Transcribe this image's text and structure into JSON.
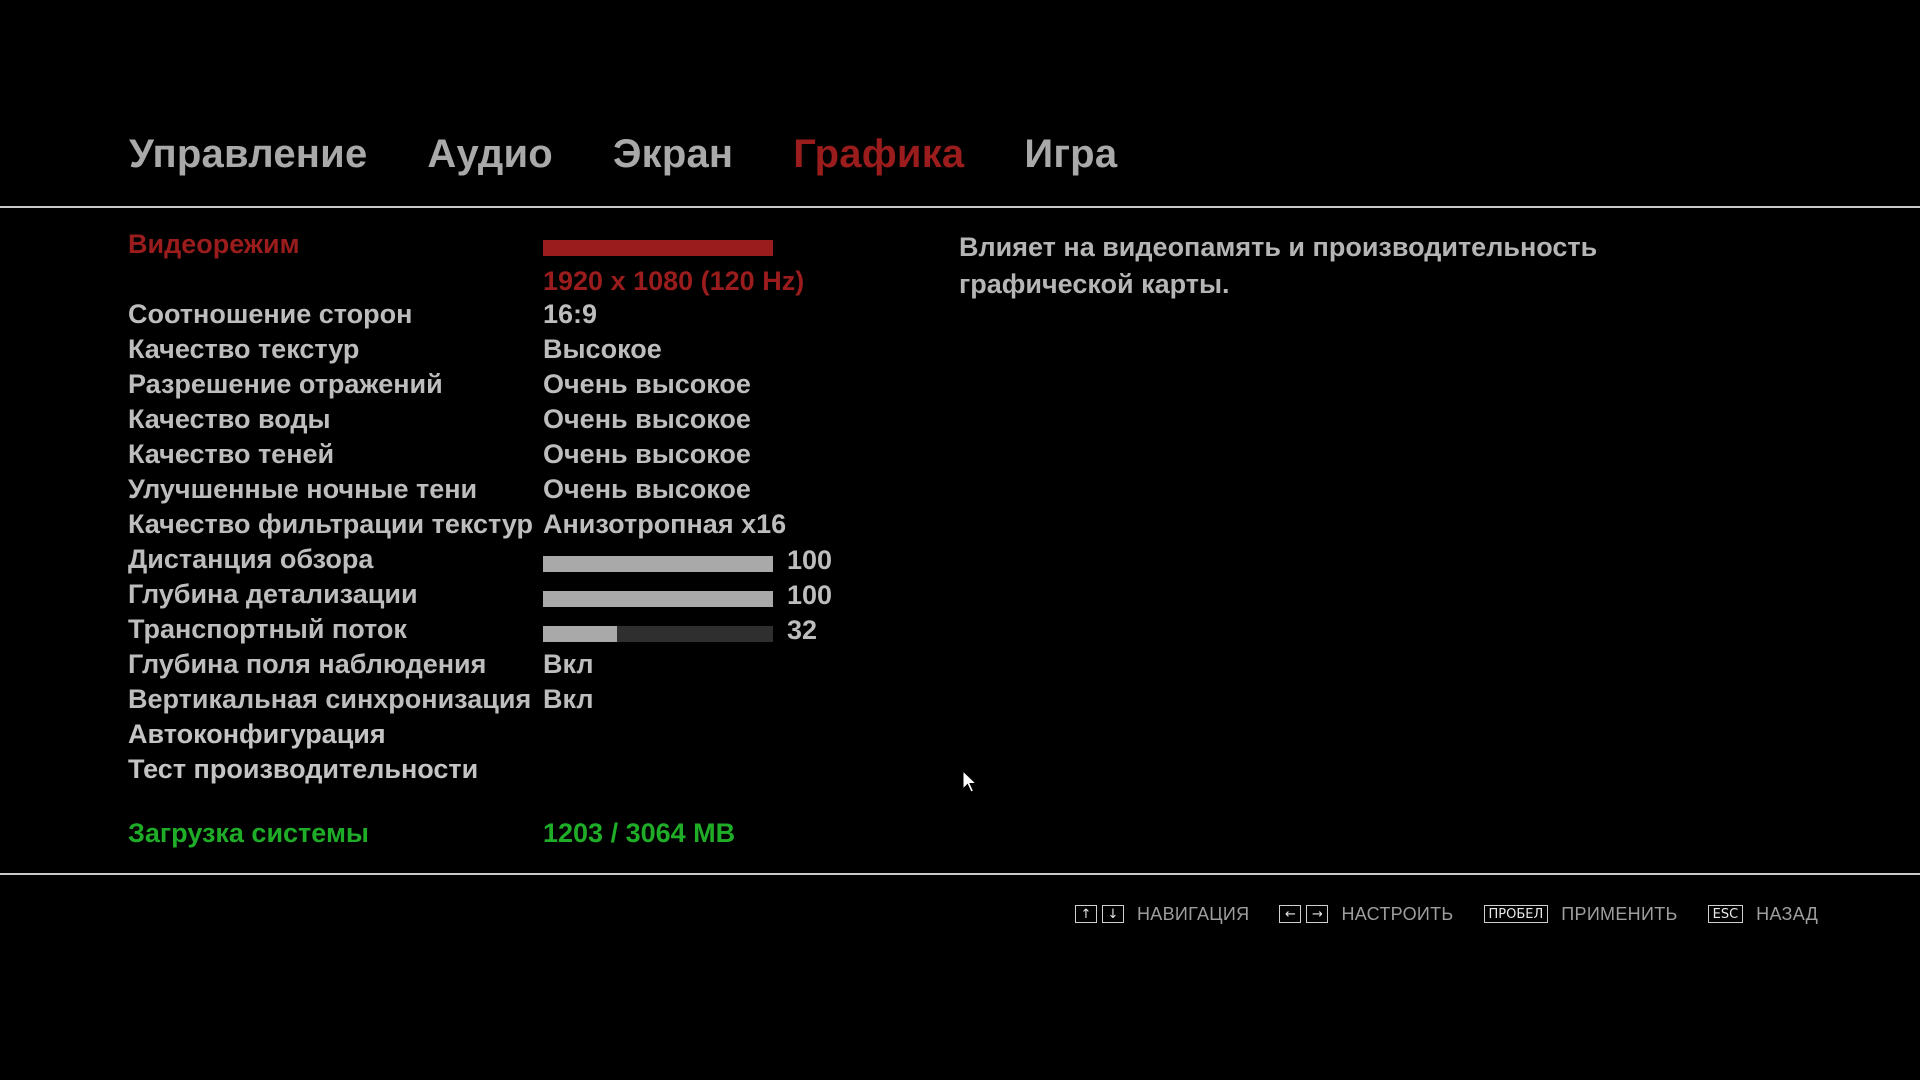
{
  "tabs": [
    {
      "label": "Управление",
      "active": false
    },
    {
      "label": "Аудио",
      "active": false
    },
    {
      "label": "Экран",
      "active": false
    },
    {
      "label": "Графика",
      "active": true
    },
    {
      "label": "Игра",
      "active": false
    }
  ],
  "settings": {
    "video_mode": {
      "label": "Видеорежим",
      "value": "1920 x 1080 (120 Hz)"
    },
    "aspect_ratio": {
      "label": "Соотношение сторон",
      "value": "16:9"
    },
    "texture_quality": {
      "label": "Качество текстур",
      "value": "Высокое"
    },
    "reflection_resolution": {
      "label": "Разрешение отражений",
      "value": "Очень высокое"
    },
    "water_quality": {
      "label": "Качество воды",
      "value": "Очень высокое"
    },
    "shadow_quality": {
      "label": "Качество теней",
      "value": "Очень высокое"
    },
    "night_shadows": {
      "label": "Улучшенные ночные тени",
      "value": "Очень высокое"
    },
    "texture_filtering": {
      "label": "Качество фильтрации текстур",
      "value": "Анизотропная x16"
    },
    "view_distance": {
      "label": "Дистанция обзора",
      "value": "100",
      "fraction": 1.0
    },
    "detail_distance": {
      "label": "Глубина детализации",
      "value": "100",
      "fraction": 1.0
    },
    "traffic": {
      "label": "Транспортный поток",
      "value": "32",
      "fraction": 0.32
    },
    "depth_of_field": {
      "label": "Глубина поля наблюдения",
      "value": "Вкл"
    },
    "vsync": {
      "label": "Вертикальная синхронизация",
      "value": "Вкл"
    },
    "autoconfig": {
      "label": "Автоконфигурация"
    },
    "benchmark": {
      "label": "Тест производительности"
    }
  },
  "system_load": {
    "label": "Загрузка системы",
    "value": "1203 / 3064 MB"
  },
  "description": {
    "line1": "Влияет на видеопамять и производительность",
    "line2": "графической карты."
  },
  "hints": {
    "navigate": {
      "keys": [
        "↑",
        "↓"
      ],
      "label": "НАВИГАЦИЯ"
    },
    "adjust": {
      "keys": [
        "←",
        "→"
      ],
      "label": "НАСТРОИТЬ"
    },
    "apply": {
      "key": "ПРОБЕЛ",
      "label": "ПРИМЕНИТЬ"
    },
    "back": {
      "key": "ESC",
      "label": "НАЗАД"
    }
  },
  "colors": {
    "accent_red": "#9a1c1c",
    "ok_green": "#1fad28",
    "text_gray": "#bdbdbd"
  }
}
